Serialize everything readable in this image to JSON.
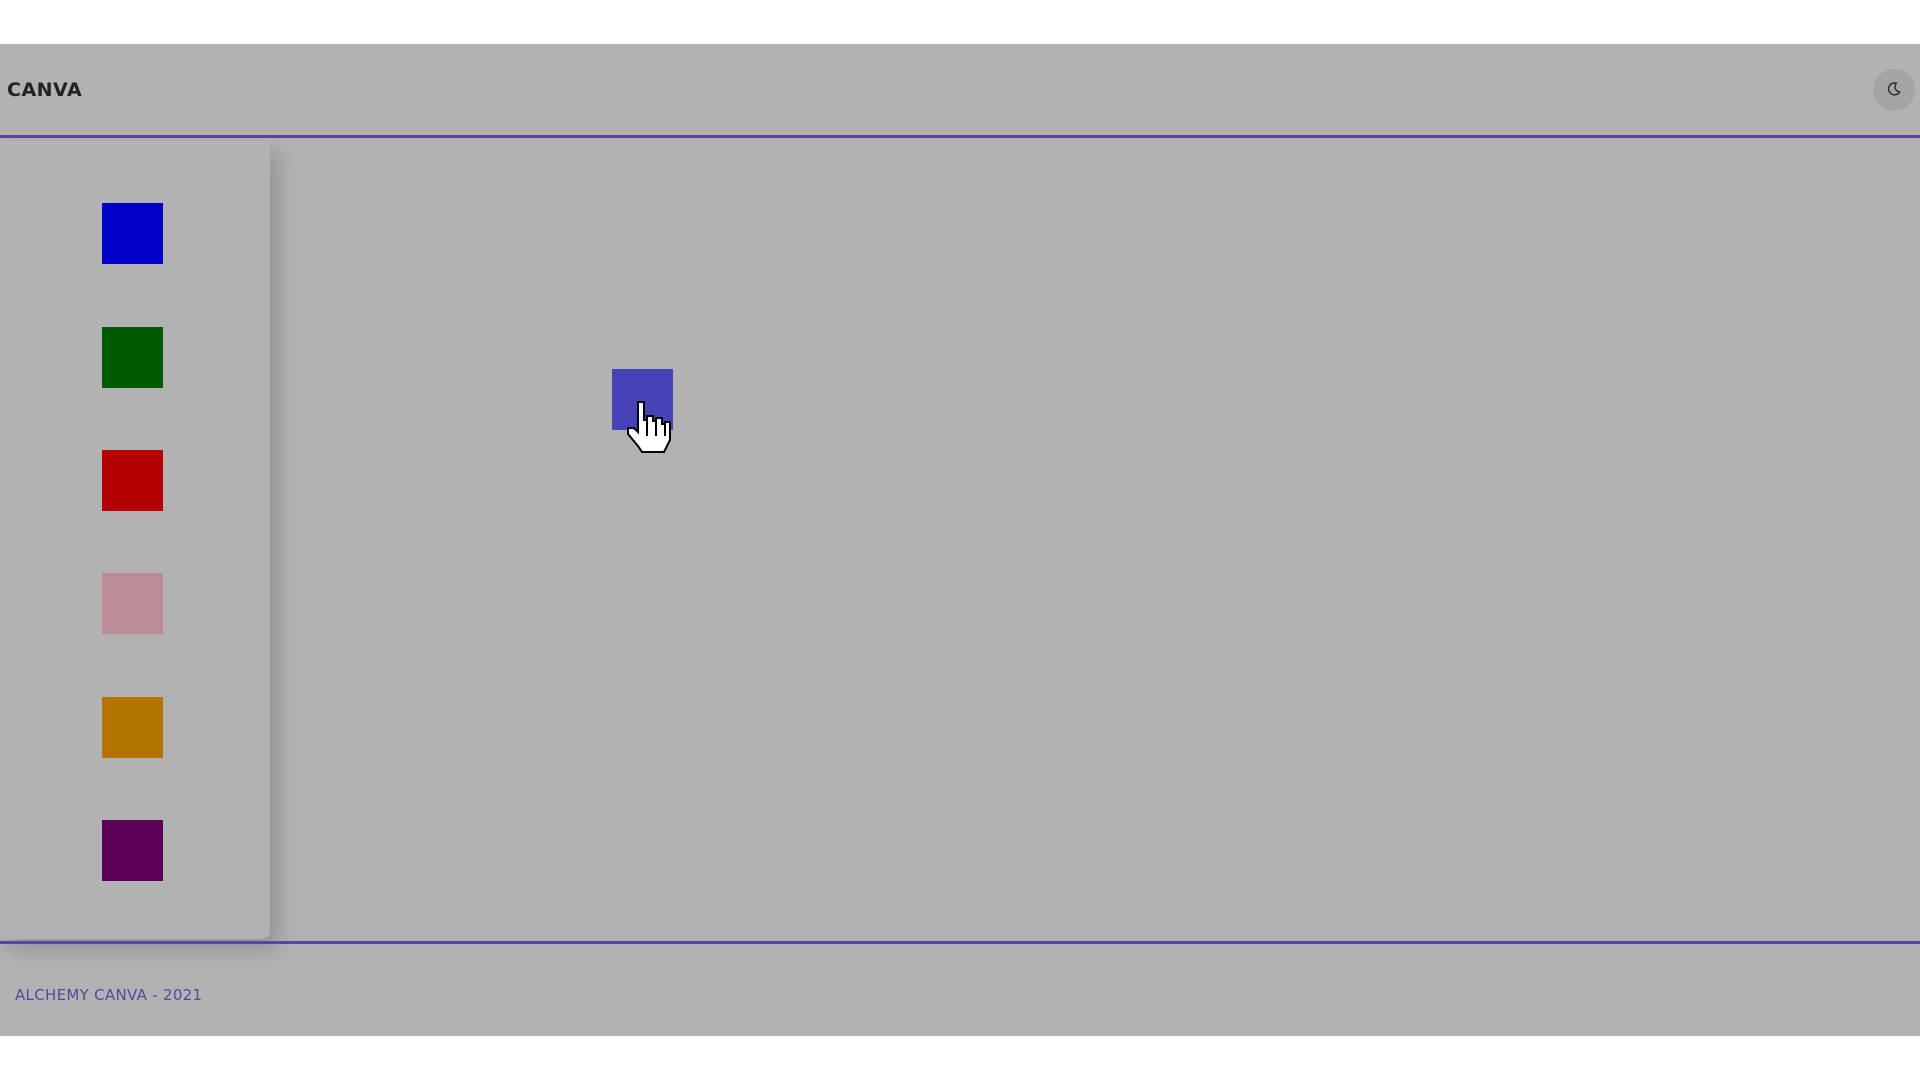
{
  "header": {
    "brand": "CANVA",
    "theme_toggle_icon": "moon-icon"
  },
  "palette": {
    "swatches": [
      {
        "name": "blue",
        "color": "#0000c8"
      },
      {
        "name": "green",
        "color": "#005a00"
      },
      {
        "name": "red",
        "color": "#b40000"
      },
      {
        "name": "pink",
        "color": "#bb8c96"
      },
      {
        "name": "orange",
        "color": "#b47400"
      },
      {
        "name": "purple",
        "color": "#5c0058"
      }
    ]
  },
  "canvas": {
    "placed_items": [
      {
        "color": "#4643b8"
      }
    ]
  },
  "footer": {
    "text": "ALCHEMY CANVA - 2021",
    "accent_color": "#5b44a0"
  },
  "cursor": {
    "icon": "hand-pointer-icon"
  }
}
